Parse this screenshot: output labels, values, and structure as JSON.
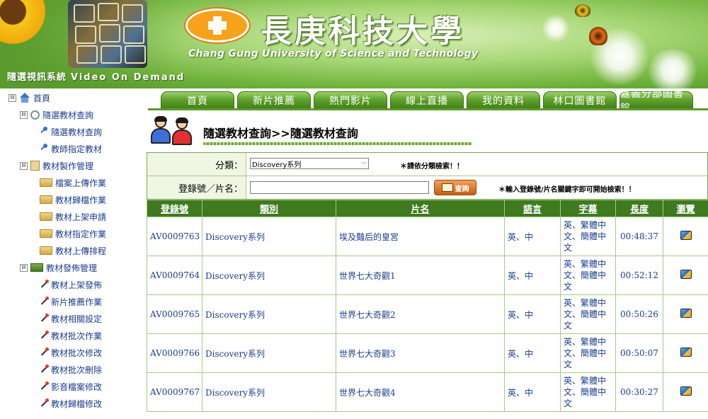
{
  "header": {
    "university_cn": "長庚科技大學",
    "university_en": "Chang Gung University of Science and Technology",
    "system_title_cn": "隨選視訊系統",
    "system_title_en": "Video On Demand"
  },
  "sidebar": {
    "items": [
      {
        "label": "首頁",
        "toggle": "⊟",
        "icon": "home-icon"
      },
      {
        "label": "隨選教材查詢",
        "toggle": "⊟",
        "icon": "search-icon"
      },
      {
        "label": "隨選教材查詢",
        "icon": "key-icon"
      },
      {
        "label": "教師指定教材",
        "icon": "key-icon"
      },
      {
        "label": "教材製作管理",
        "toggle": "⊟",
        "icon": "doc-icon"
      },
      {
        "label": "檔案上傳作業",
        "icon": "folder-icon"
      },
      {
        "label": "教材歸檔作業",
        "icon": "folder-icon"
      },
      {
        "label": "教材上架申請",
        "icon": "folder-icon"
      },
      {
        "label": "教材指定作業",
        "icon": "folder-icon"
      },
      {
        "label": "教材上傳排程",
        "icon": "folder-icon"
      },
      {
        "label": "教材發佈管理",
        "toggle": "⊟",
        "icon": "image-icon"
      },
      {
        "label": "教材上架發佈",
        "icon": "wand-icon"
      },
      {
        "label": "新片推薦作業",
        "icon": "wand-icon"
      },
      {
        "label": "教材相關設定",
        "icon": "wand-icon"
      },
      {
        "label": "教材批次作業",
        "icon": "wand-icon"
      },
      {
        "label": "教材批次修改",
        "icon": "wand-icon"
      },
      {
        "label": "教材批次刪除",
        "icon": "wand-icon"
      },
      {
        "label": "影音檔案修改",
        "icon": "wand-icon"
      },
      {
        "label": "教材歸檔修改",
        "icon": "wand-icon"
      }
    ]
  },
  "nav": {
    "tabs": [
      "首頁",
      "新片推薦",
      "熱門影片",
      "線上直播",
      "我的資料",
      "林口圖書館",
      "嘉義分部圖書館"
    ]
  },
  "page": {
    "title": "隨選教材查詢>>隨選教材查詢"
  },
  "filter": {
    "category_label": "分類：",
    "category_value": "Discovery系列",
    "category_hint": "＊請依分類檢索！！",
    "keyword_label": "登錄號／片名：",
    "keyword_value": "",
    "query_button": "查詢",
    "keyword_hint": "＊輸入登錄號/片名關鍵字即可開始檢索！！"
  },
  "table": {
    "headers": [
      "登錄號",
      "類別",
      "片名",
      "語言",
      "字幕",
      "長度",
      "瀏覽"
    ],
    "rows": [
      {
        "id": "AV0009763",
        "category": "Discovery系列",
        "title": "埃及豔后的皇宮",
        "language": "英、中",
        "subtitles": "英、繁體中文、簡體中文",
        "length": "00:48:37"
      },
      {
        "id": "AV0009764",
        "category": "Discovery系列",
        "title": "世界七大奇觀1",
        "language": "英、中",
        "subtitles": "英、繁體中文、簡體中文",
        "length": "00:52:12"
      },
      {
        "id": "AV0009765",
        "category": "Discovery系列",
        "title": "世界七大奇觀2",
        "language": "英、中",
        "subtitles": "英、繁體中文、簡體中文",
        "length": "00:50:26"
      },
      {
        "id": "AV0009766",
        "category": "Discovery系列",
        "title": "世界七大奇觀3",
        "language": "英、中",
        "subtitles": "英、繁體中文、簡體中文",
        "length": "00:50:07"
      },
      {
        "id": "AV0009767",
        "category": "Discovery系列",
        "title": "世界七大奇觀4",
        "language": "英、中",
        "subtitles": "英、繁體中文、簡體中文",
        "length": "00:30:27"
      }
    ]
  },
  "colors": {
    "accent_green": "#3f7a1e",
    "link_blue": "#1a3d8f",
    "filter_bg": "#eff7e3"
  }
}
